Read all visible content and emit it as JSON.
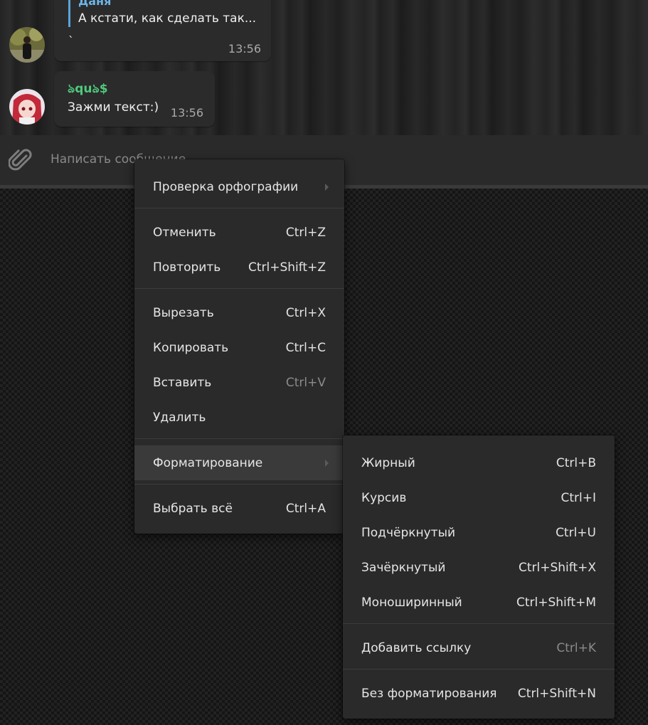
{
  "chat": {
    "message1": {
      "reply_name": "Даня",
      "reply_text": "А кстати, как сделать так...",
      "text": "`",
      "time": "13:56"
    },
    "message2": {
      "sender": "ঌquঌ$",
      "text": "Зажми текст:)",
      "time": "13:56"
    }
  },
  "input": {
    "placeholder": "Написать сообщение"
  },
  "context_menu": {
    "spellcheck": "Проверка орфографии",
    "undo": {
      "label": "Отменить",
      "shortcut": "Ctrl+Z"
    },
    "redo": {
      "label": "Повторить",
      "shortcut": "Ctrl+Shift+Z"
    },
    "cut": {
      "label": "Вырезать",
      "shortcut": "Ctrl+X"
    },
    "copy": {
      "label": "Копировать",
      "shortcut": "Ctrl+C"
    },
    "paste": {
      "label": "Вставить",
      "shortcut": "Ctrl+V"
    },
    "delete": {
      "label": "Удалить"
    },
    "formatting": {
      "label": "Форматирование"
    },
    "select_all": {
      "label": "Выбрать всё",
      "shortcut": "Ctrl+A"
    }
  },
  "format_menu": {
    "bold": {
      "label": "Жирный",
      "shortcut": "Ctrl+B"
    },
    "italic": {
      "label": "Курсив",
      "shortcut": "Ctrl+I"
    },
    "underline": {
      "label": "Подчёркнутый",
      "shortcut": "Ctrl+U"
    },
    "strike": {
      "label": "Зачёркнутый",
      "shortcut": "Ctrl+Shift+X"
    },
    "mono": {
      "label": "Моноширинный",
      "shortcut": "Ctrl+Shift+M"
    },
    "link": {
      "label": "Добавить ссылку",
      "shortcut": "Ctrl+K"
    },
    "clear": {
      "label": "Без форматирования",
      "shortcut": "Ctrl+Shift+N"
    }
  },
  "colors": {
    "reply_accent": "#5aa4d9",
    "sender_name": "#4fc97d",
    "menu_bg": "#2a2a2a",
    "menu_highlight": "#3a3a3a"
  }
}
